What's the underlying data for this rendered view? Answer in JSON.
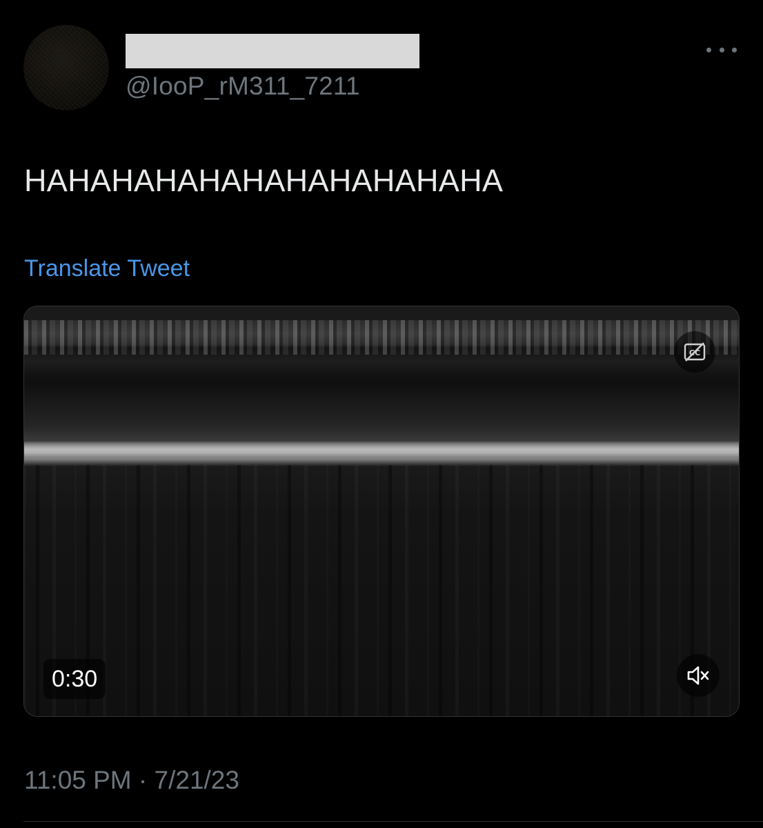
{
  "author": {
    "handle": "@IooP_rM311_7211"
  },
  "tweet": {
    "text": "HAHAHAHAHAHAHAHAHAHAHA",
    "translate_label": "Translate Tweet",
    "timestamp": "11:05 PM · 7/21/23"
  },
  "media": {
    "duration": "0:30"
  },
  "icons": {
    "more": "more-horizontal-icon",
    "captions": "closed-captions-off-icon",
    "mute": "volume-muted-icon"
  },
  "colors": {
    "background": "#000000",
    "text": "#e7e9ea",
    "secondary_text": "#6e767d",
    "link": "#4a97e8"
  }
}
